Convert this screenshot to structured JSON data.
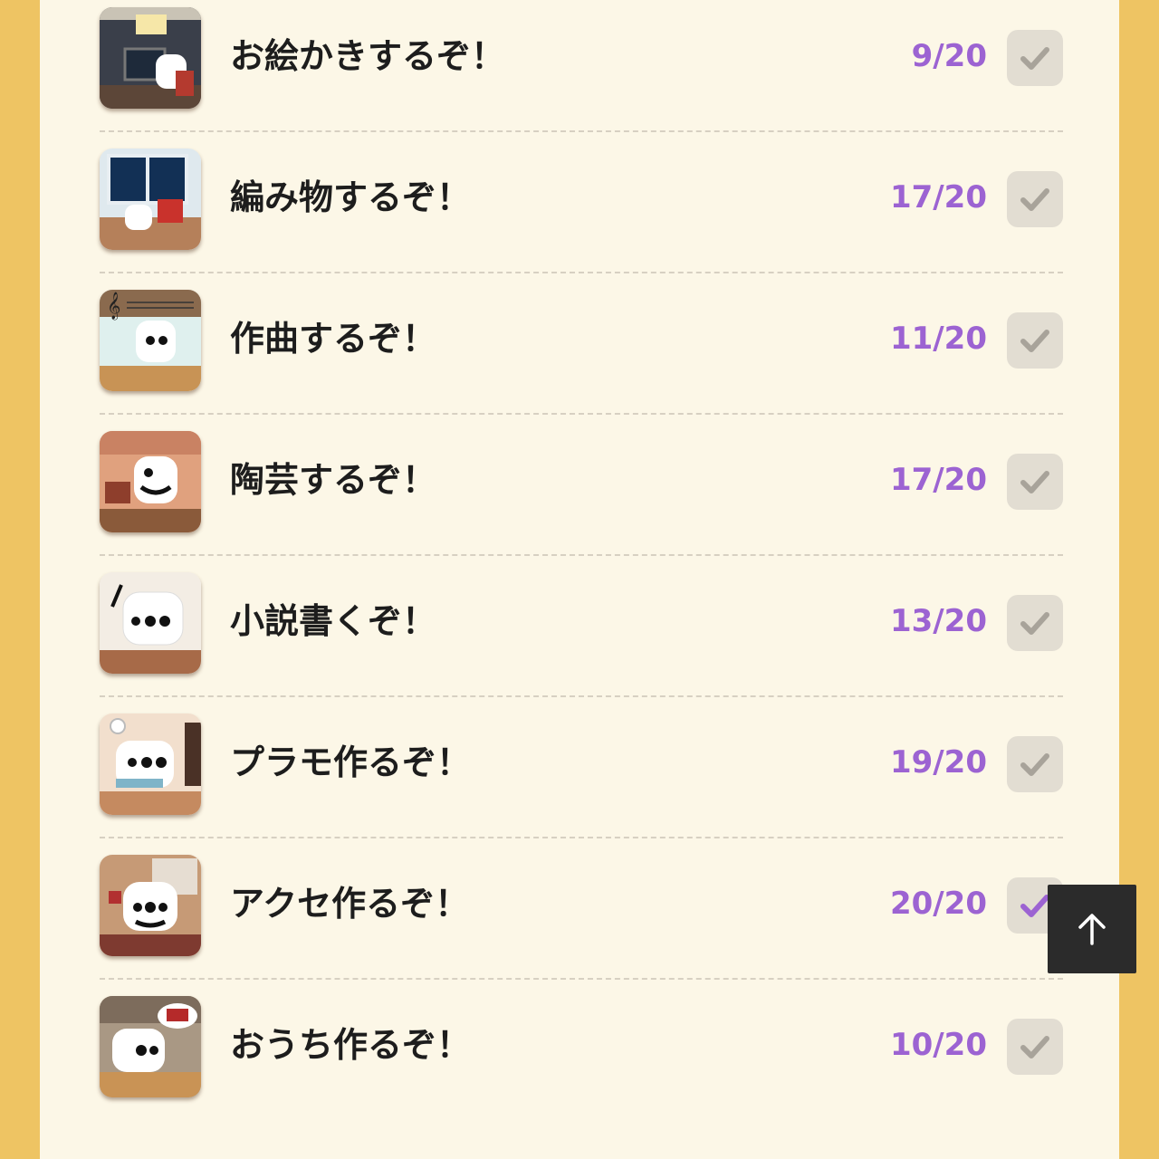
{
  "colors": {
    "background": "#eec463",
    "panel": "#fcf7e7",
    "progress_text": "#9c63d2",
    "check_done": "#9c63d2",
    "check_pending": "#a8a39a"
  },
  "list": {
    "items": [
      {
        "title": "お絵かきするぞ！",
        "progress": "9/20",
        "completed": false,
        "icon": "drawing-thumbnail"
      },
      {
        "title": "編み物するぞ！",
        "progress": "17/20",
        "completed": false,
        "icon": "knitting-thumbnail"
      },
      {
        "title": "作曲するぞ！",
        "progress": "11/20",
        "completed": false,
        "icon": "composing-thumbnail"
      },
      {
        "title": "陶芸するぞ！",
        "progress": "17/20",
        "completed": false,
        "icon": "pottery-thumbnail"
      },
      {
        "title": "小説書くぞ！",
        "progress": "13/20",
        "completed": false,
        "icon": "novel-thumbnail"
      },
      {
        "title": "プラモ作るぞ！",
        "progress": "19/20",
        "completed": false,
        "icon": "plamodel-thumbnail"
      },
      {
        "title": "アクセ作るぞ！",
        "progress": "20/20",
        "completed": true,
        "icon": "accessory-thumbnail"
      },
      {
        "title": "おうち作るぞ！",
        "progress": "10/20",
        "completed": false,
        "icon": "house-thumbnail"
      }
    ]
  },
  "scroll_top": {
    "icon": "arrow-up-icon"
  }
}
